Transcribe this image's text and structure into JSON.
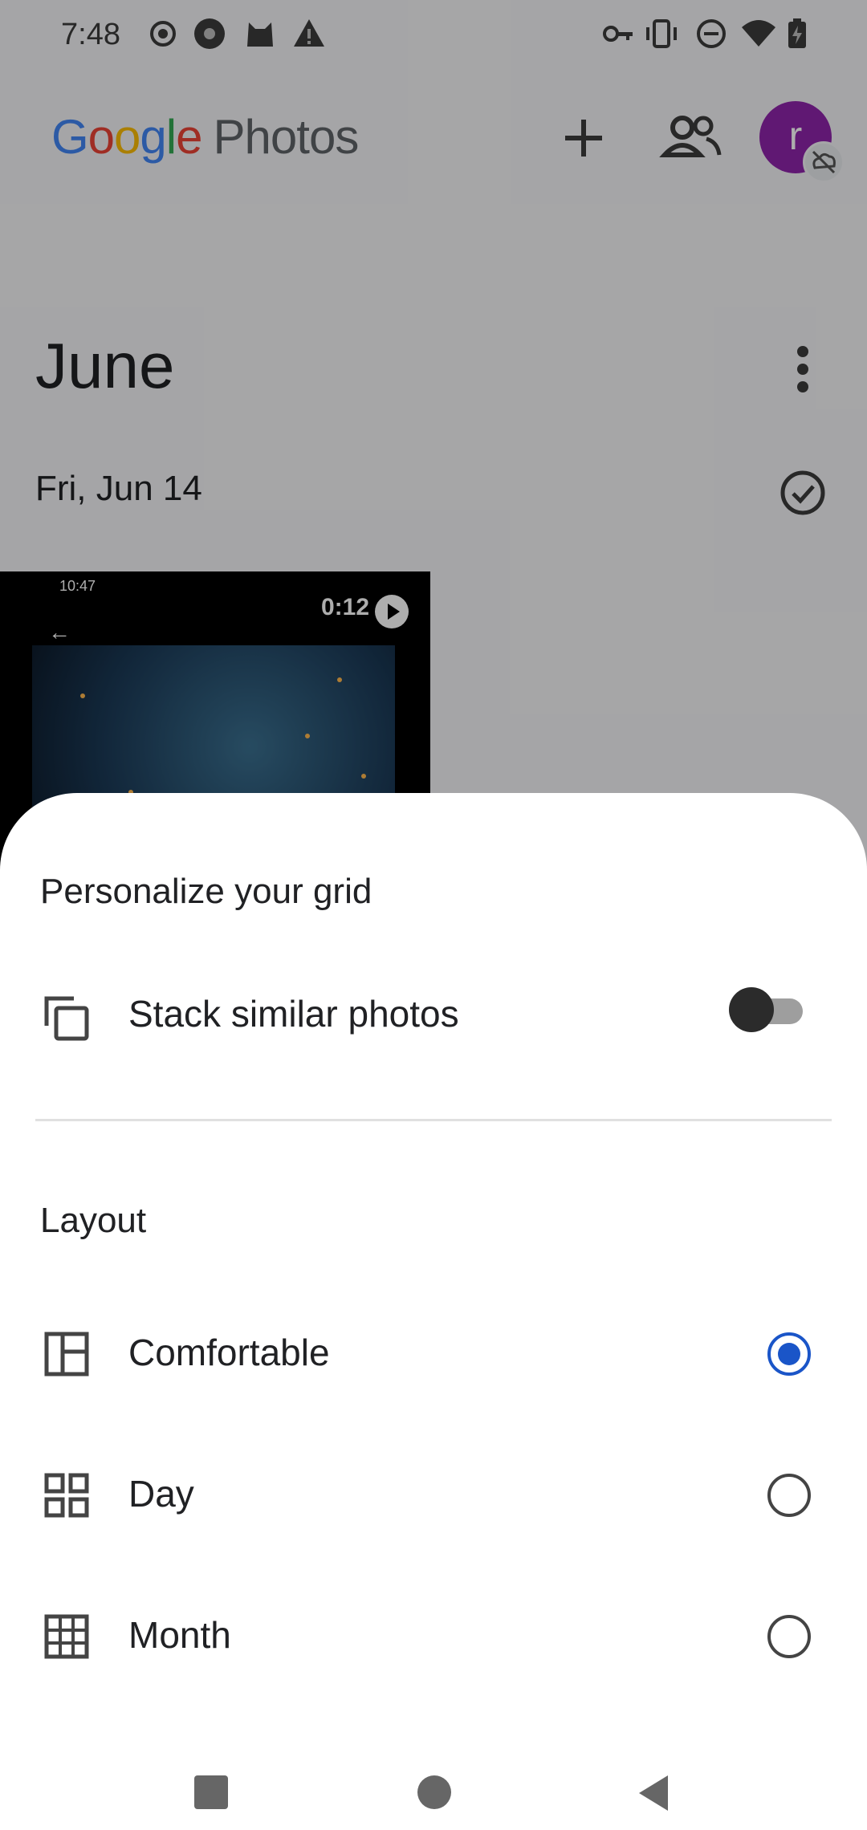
{
  "status_bar": {
    "time": "7:48",
    "left_icons": [
      "record-icon",
      "chrome-icon",
      "cat-icon",
      "warning-icon"
    ],
    "right_icons": [
      "vpn-key-icon",
      "vibrate-icon",
      "dnd-icon",
      "wifi-icon",
      "battery-charging-icon"
    ]
  },
  "app_bar": {
    "logo_google": [
      "G",
      "o",
      "o",
      "g",
      "l",
      "e"
    ],
    "logo_product": "Photos",
    "avatar_initial": "r"
  },
  "timeline": {
    "month": "June",
    "date": "Fri, Jun 14",
    "thumbnail": {
      "duration": "0:12",
      "mini_time": "10:47"
    }
  },
  "sheet": {
    "title": "Personalize your grid",
    "stack_label": "Stack similar photos",
    "stack_enabled": false,
    "layout_heading": "Layout",
    "options": [
      {
        "label": "Comfortable",
        "icon": "comfortable-layout-icon",
        "selected": true
      },
      {
        "label": "Day",
        "icon": "day-grid-icon",
        "selected": false
      },
      {
        "label": "Month",
        "icon": "month-grid-icon",
        "selected": false
      }
    ]
  },
  "colors": {
    "accent": "#1a55c8",
    "avatar": "#8e24aa"
  }
}
